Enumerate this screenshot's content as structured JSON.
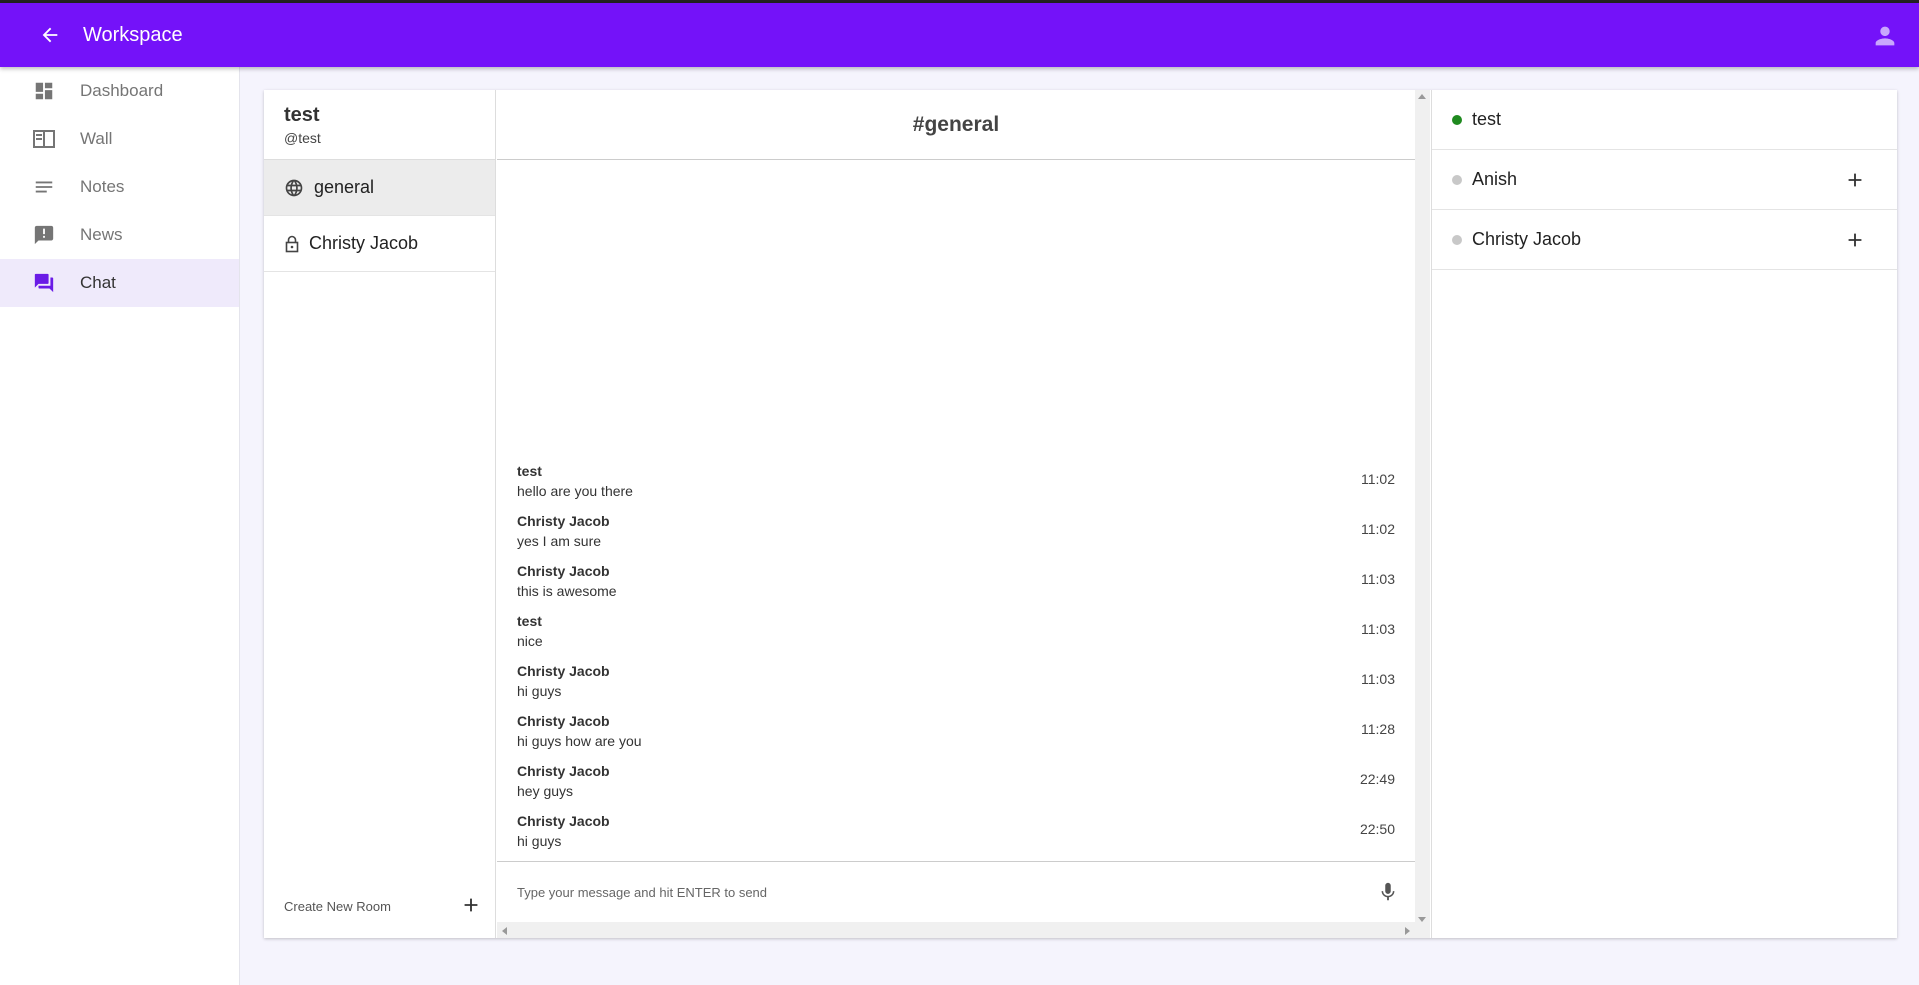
{
  "appbar": {
    "title": "Workspace",
    "back_icon": "arrow-back-icon",
    "account_icon": "account-icon"
  },
  "colors": {
    "brand": "#7412f9",
    "online": "#1f8a1f",
    "offline": "#c8c8c8",
    "active_nav_bg": "#efeafb"
  },
  "sidebar": {
    "items": [
      {
        "label": "Dashboard",
        "icon": "dashboard-icon",
        "active": false
      },
      {
        "label": "Wall",
        "icon": "wall-icon",
        "active": false
      },
      {
        "label": "Notes",
        "icon": "notes-icon",
        "active": false
      },
      {
        "label": "News",
        "icon": "news-icon",
        "active": false
      },
      {
        "label": "Chat",
        "icon": "chat-icon",
        "active": true
      }
    ]
  },
  "user": {
    "name": "test",
    "handle": "@test"
  },
  "rooms": [
    {
      "label": "general",
      "icon": "globe-icon",
      "active": true
    },
    {
      "label": "Christy Jacob",
      "icon": "lock-icon",
      "active": false
    }
  ],
  "create_room": {
    "label": "Create New Room",
    "icon": "plus-icon"
  },
  "chat": {
    "title": "#general",
    "messages": [
      {
        "author": "test",
        "text": "hello are you there",
        "time": "11:02"
      },
      {
        "author": "Christy Jacob",
        "text": "yes I am sure",
        "time": "11:02"
      },
      {
        "author": "Christy Jacob",
        "text": "this is awesome",
        "time": "11:03"
      },
      {
        "author": "test",
        "text": "nice",
        "time": "11:03"
      },
      {
        "author": "Christy Jacob",
        "text": "hi guys",
        "time": "11:03"
      },
      {
        "author": "Christy Jacob",
        "text": "hi guys how are you",
        "time": "11:28"
      },
      {
        "author": "Christy Jacob",
        "text": "hey guys",
        "time": "22:49"
      },
      {
        "author": "Christy Jacob",
        "text": "hi guys",
        "time": "22:50"
      }
    ],
    "composer": {
      "placeholder": "Type your message and hit ENTER to send",
      "value": "",
      "mic_icon": "mic-icon"
    }
  },
  "members": [
    {
      "name": "test",
      "status": "online",
      "can_add": false
    },
    {
      "name": "Anish",
      "status": "offline",
      "can_add": true
    },
    {
      "name": "Christy Jacob",
      "status": "offline",
      "can_add": true
    }
  ]
}
